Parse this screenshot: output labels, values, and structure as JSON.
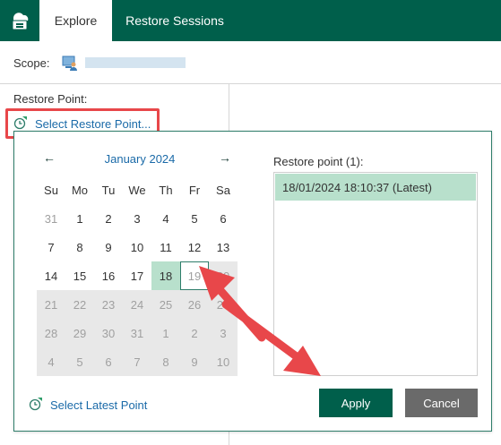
{
  "colors": {
    "brand": "#005f4b",
    "link": "#1a6aa8",
    "selection": "#b8e0cc",
    "annotation": "#e8474a"
  },
  "tabs": [
    {
      "label": "Explore",
      "active": true
    },
    {
      "label": "Restore Sessions",
      "active": false
    }
  ],
  "scope": {
    "label": "Scope:",
    "icon": "user-computer-icon"
  },
  "restore_point": {
    "label": "Restore Point:",
    "select_link": "Select Restore Point...",
    "icon": "clock-icon"
  },
  "calendar": {
    "month_label": "January 2024",
    "prev_icon": "arrow-left-icon",
    "next_icon": "arrow-right-icon",
    "weekdays": [
      "Su",
      "Mo",
      "Tu",
      "We",
      "Th",
      "Fr",
      "Sa"
    ],
    "weeks": [
      [
        "31",
        "1",
        "2",
        "3",
        "4",
        "5",
        "6"
      ],
      [
        "7",
        "8",
        "9",
        "10",
        "11",
        "12",
        "13"
      ],
      [
        "14",
        "15",
        "16",
        "17",
        "18",
        "19",
        "20"
      ],
      [
        "21",
        "22",
        "23",
        "24",
        "25",
        "26",
        "27"
      ],
      [
        "28",
        "29",
        "30",
        "31",
        "1",
        "2",
        "3"
      ],
      [
        "4",
        "5",
        "6",
        "7",
        "8",
        "9",
        "10"
      ]
    ],
    "selected_day": "18",
    "today_day": "19"
  },
  "restore_point_list": {
    "label": "Restore point (1):",
    "items": [
      "18/01/2024 18:10:37 (Latest)"
    ]
  },
  "latest_link": "Select Latest Point",
  "buttons": {
    "apply": "Apply",
    "cancel": "Cancel"
  }
}
